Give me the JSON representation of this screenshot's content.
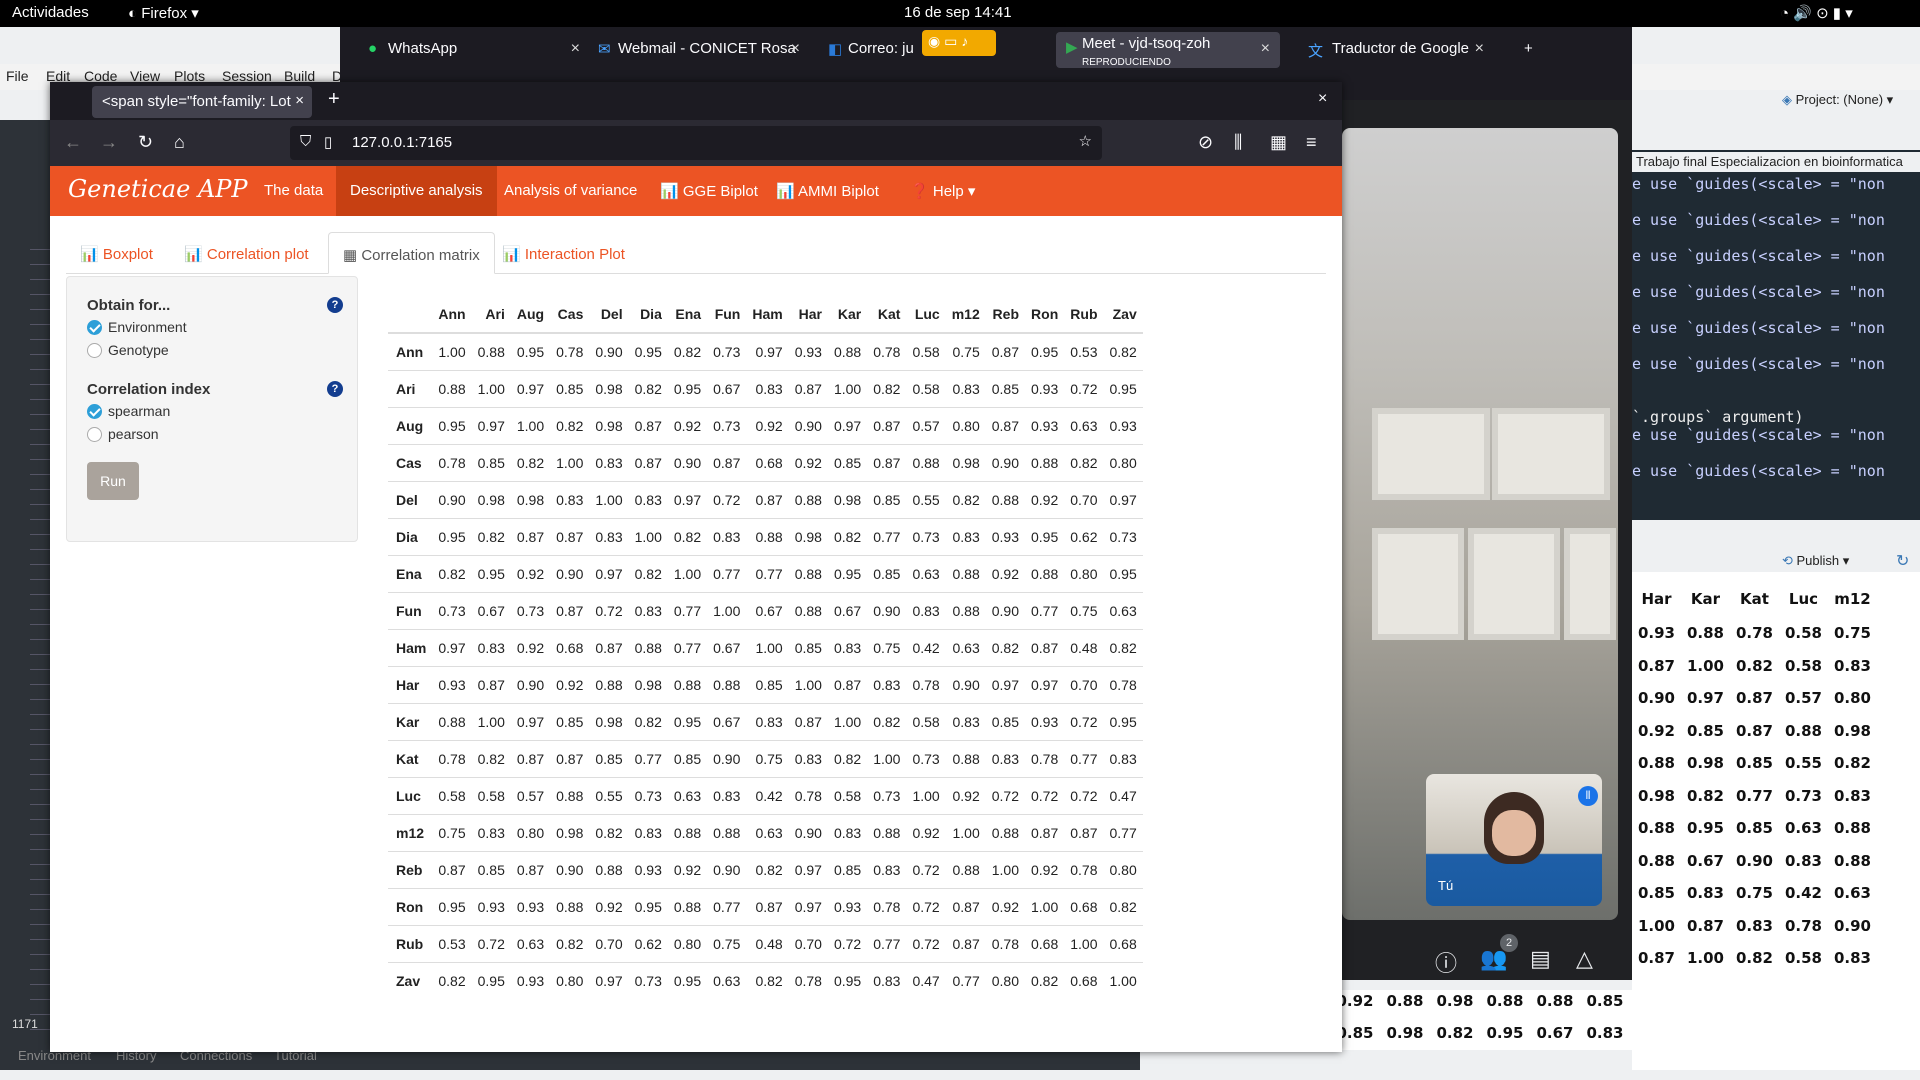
{
  "system": {
    "activities": "Actividades",
    "app": "Firefox",
    "clock": "16 de sep  14:41"
  },
  "rstudio": {
    "menu": [
      "File",
      "Edit",
      "Code",
      "View",
      "Plots",
      "Session",
      "Build",
      "D"
    ],
    "project": "Project: (None)",
    "console_title": "Trabajo final Especializacion en bioinformatica",
    "console_lines": [
      "e use `guides(<scale> = \"non",
      "e use `guides(<scale> = \"non",
      "e use `guides(<scale> = \"non",
      "e use `guides(<scale> = \"non",
      "e use `guides(<scale> = \"non",
      "e use `guides(<scale> = \"non"
    ],
    "console_groups": "`.groups` argument)",
    "console_lines2": [
      "e use `guides(<scale> = \"non",
      "e use `guides(<scale> = \"non"
    ],
    "publish": "Publish",
    "bottom_tabs": [
      "Environment",
      "History",
      "Connections",
      "Tutorial"
    ],
    "line_num": "1171",
    "side_table_headers": [
      "Har",
      "Kar",
      "Kat",
      "Luc",
      "m12"
    ],
    "side_table_rows": [
      [
        "0.93",
        "0.88",
        "0.78",
        "0.58",
        "0.75"
      ],
      [
        "0.87",
        "1.00",
        "0.82",
        "0.58",
        "0.83"
      ],
      [
        "0.90",
        "0.97",
        "0.87",
        "0.57",
        "0.80"
      ],
      [
        "0.92",
        "0.85",
        "0.87",
        "0.88",
        "0.98"
      ],
      [
        "0.88",
        "0.98",
        "0.85",
        "0.55",
        "0.82"
      ],
      [
        "0.98",
        "0.82",
        "0.77",
        "0.73",
        "0.83"
      ],
      [
        "0.88",
        "0.95",
        "0.85",
        "0.63",
        "0.88"
      ],
      [
        "0.88",
        "0.67",
        "0.90",
        "0.83",
        "0.88"
      ],
      [
        "0.85",
        "0.83",
        "0.75",
        "0.42",
        "0.63"
      ],
      [
        "1.00",
        "0.87",
        "0.83",
        "0.78",
        "0.90"
      ],
      [
        "0.87",
        "1.00",
        "0.82",
        "0.58",
        "0.83"
      ]
    ],
    "bottom_table_rows": [
      [
        "0.92",
        "0.88",
        "0.98",
        "0.88",
        "0.88",
        "0.85"
      ],
      [
        "0.85",
        "0.98",
        "0.82",
        "0.95",
        "0.67",
        "0.83"
      ]
    ]
  },
  "back_browser": {
    "tabs": [
      {
        "label": "WhatsApp"
      },
      {
        "label": "Webmail - CONICET Rosa"
      },
      {
        "label": "Correo: ju"
      },
      {
        "label": "Meet - vjd-tsoq-zoh",
        "sub": "REPRODUCIENDO"
      },
      {
        "label": "Traductor de Google"
      }
    ],
    "meet_self": "Tú",
    "participants": "2"
  },
  "browser": {
    "tab_title": "<span style=\"font-family: Lot",
    "url": "127.0.0.1:7165"
  },
  "app": {
    "brand": "Geneticae APP",
    "nav": [
      "The data",
      "Descriptive analysis",
      "Analysis of variance",
      "GGE Biplot",
      "AMMI Biplot",
      "Help"
    ],
    "subtabs": [
      "Boxplot",
      "Correlation plot",
      "Correlation matrix",
      "Interaction Plot"
    ],
    "sidebar": {
      "obtain_label": "Obtain for...",
      "obtain_options": [
        "Environment",
        "Genotype"
      ],
      "index_label": "Correlation index",
      "index_options": [
        "spearman",
        "pearson"
      ],
      "run": "Run"
    },
    "matrix": {
      "headers": [
        "Ann",
        "Ari",
        "Aug",
        "Cas",
        "Del",
        "Dia",
        "Ena",
        "Fun",
        "Ham",
        "Har",
        "Kar",
        "Kat",
        "Luc",
        "m12",
        "Reb",
        "Ron",
        "Rub",
        "Zav"
      ],
      "rows": [
        [
          "Ann",
          "1.00",
          "0.88",
          "0.95",
          "0.78",
          "0.90",
          "0.95",
          "0.82",
          "0.73",
          "0.97",
          "0.93",
          "0.88",
          "0.78",
          "0.58",
          "0.75",
          "0.87",
          "0.95",
          "0.53",
          "0.82"
        ],
        [
          "Ari",
          "0.88",
          "1.00",
          "0.97",
          "0.85",
          "0.98",
          "0.82",
          "0.95",
          "0.67",
          "0.83",
          "0.87",
          "1.00",
          "0.82",
          "0.58",
          "0.83",
          "0.85",
          "0.93",
          "0.72",
          "0.95"
        ],
        [
          "Aug",
          "0.95",
          "0.97",
          "1.00",
          "0.82",
          "0.98",
          "0.87",
          "0.92",
          "0.73",
          "0.92",
          "0.90",
          "0.97",
          "0.87",
          "0.57",
          "0.80",
          "0.87",
          "0.93",
          "0.63",
          "0.93"
        ],
        [
          "Cas",
          "0.78",
          "0.85",
          "0.82",
          "1.00",
          "0.83",
          "0.87",
          "0.90",
          "0.87",
          "0.68",
          "0.92",
          "0.85",
          "0.87",
          "0.88",
          "0.98",
          "0.90",
          "0.88",
          "0.82",
          "0.80"
        ],
        [
          "Del",
          "0.90",
          "0.98",
          "0.98",
          "0.83",
          "1.00",
          "0.83",
          "0.97",
          "0.72",
          "0.87",
          "0.88",
          "0.98",
          "0.85",
          "0.55",
          "0.82",
          "0.88",
          "0.92",
          "0.70",
          "0.97"
        ],
        [
          "Dia",
          "0.95",
          "0.82",
          "0.87",
          "0.87",
          "0.83",
          "1.00",
          "0.82",
          "0.83",
          "0.88",
          "0.98",
          "0.82",
          "0.77",
          "0.73",
          "0.83",
          "0.93",
          "0.95",
          "0.62",
          "0.73"
        ],
        [
          "Ena",
          "0.82",
          "0.95",
          "0.92",
          "0.90",
          "0.97",
          "0.82",
          "1.00",
          "0.77",
          "0.77",
          "0.88",
          "0.95",
          "0.85",
          "0.63",
          "0.88",
          "0.92",
          "0.88",
          "0.80",
          "0.95"
        ],
        [
          "Fun",
          "0.73",
          "0.67",
          "0.73",
          "0.87",
          "0.72",
          "0.83",
          "0.77",
          "1.00",
          "0.67",
          "0.88",
          "0.67",
          "0.90",
          "0.83",
          "0.88",
          "0.90",
          "0.77",
          "0.75",
          "0.63"
        ],
        [
          "Ham",
          "0.97",
          "0.83",
          "0.92",
          "0.68",
          "0.87",
          "0.88",
          "0.77",
          "0.67",
          "1.00",
          "0.85",
          "0.83",
          "0.75",
          "0.42",
          "0.63",
          "0.82",
          "0.87",
          "0.48",
          "0.82"
        ],
        [
          "Har",
          "0.93",
          "0.87",
          "0.90",
          "0.92",
          "0.88",
          "0.98",
          "0.88",
          "0.88",
          "0.85",
          "1.00",
          "0.87",
          "0.83",
          "0.78",
          "0.90",
          "0.97",
          "0.97",
          "0.70",
          "0.78"
        ],
        [
          "Kar",
          "0.88",
          "1.00",
          "0.97",
          "0.85",
          "0.98",
          "0.82",
          "0.95",
          "0.67",
          "0.83",
          "0.87",
          "1.00",
          "0.82",
          "0.58",
          "0.83",
          "0.85",
          "0.93",
          "0.72",
          "0.95"
        ],
        [
          "Kat",
          "0.78",
          "0.82",
          "0.87",
          "0.87",
          "0.85",
          "0.77",
          "0.85",
          "0.90",
          "0.75",
          "0.83",
          "0.82",
          "1.00",
          "0.73",
          "0.88",
          "0.83",
          "0.78",
          "0.77",
          "0.83"
        ],
        [
          "Luc",
          "0.58",
          "0.58",
          "0.57",
          "0.88",
          "0.55",
          "0.73",
          "0.63",
          "0.83",
          "0.42",
          "0.78",
          "0.58",
          "0.73",
          "1.00",
          "0.92",
          "0.72",
          "0.72",
          "0.72",
          "0.47"
        ],
        [
          "m12",
          "0.75",
          "0.83",
          "0.80",
          "0.98",
          "0.82",
          "0.83",
          "0.88",
          "0.88",
          "0.63",
          "0.90",
          "0.83",
          "0.88",
          "0.92",
          "1.00",
          "0.88",
          "0.87",
          "0.87",
          "0.77"
        ],
        [
          "Reb",
          "0.87",
          "0.85",
          "0.87",
          "0.90",
          "0.88",
          "0.93",
          "0.92",
          "0.90",
          "0.82",
          "0.97",
          "0.85",
          "0.83",
          "0.72",
          "0.88",
          "1.00",
          "0.92",
          "0.78",
          "0.80"
        ],
        [
          "Ron",
          "0.95",
          "0.93",
          "0.93",
          "0.88",
          "0.92",
          "0.95",
          "0.88",
          "0.77",
          "0.87",
          "0.97",
          "0.93",
          "0.78",
          "0.72",
          "0.87",
          "0.92",
          "1.00",
          "0.68",
          "0.82"
        ],
        [
          "Rub",
          "0.53",
          "0.72",
          "0.63",
          "0.82",
          "0.70",
          "0.62",
          "0.80",
          "0.75",
          "0.48",
          "0.70",
          "0.72",
          "0.77",
          "0.72",
          "0.87",
          "0.78",
          "0.68",
          "1.00",
          "0.68"
        ],
        [
          "Zav",
          "0.82",
          "0.95",
          "0.93",
          "0.80",
          "0.97",
          "0.73",
          "0.95",
          "0.63",
          "0.82",
          "0.78",
          "0.95",
          "0.83",
          "0.47",
          "0.77",
          "0.80",
          "0.82",
          "0.68",
          "1.00"
        ]
      ]
    }
  }
}
